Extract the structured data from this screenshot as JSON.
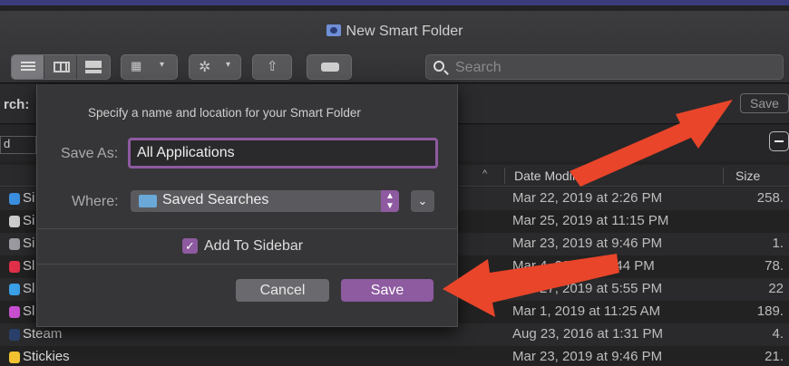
{
  "window": {
    "title": "New Smart Folder"
  },
  "toolbar": {
    "search_placeholder": "Search"
  },
  "criteria": {
    "label": "rch:",
    "header_save": "Save",
    "field_fragment": "d"
  },
  "columns": {
    "date_modified": "Date Modified",
    "size": "Size",
    "sort_indicator": "^"
  },
  "files": [
    {
      "name": "Si",
      "date": "Mar 22, 2019 at 2:26 PM",
      "size": "258.",
      "icon_color": "#3b8fe0"
    },
    {
      "name": "Si",
      "date": "Mar 25, 2019 at 11:15 PM",
      "size": "",
      "icon_color": "#cccccc"
    },
    {
      "name": "Si",
      "date": "Mar 23, 2019 at 9:46 PM",
      "size": "1.",
      "icon_color": "#9a9aa0"
    },
    {
      "name": "Sl",
      "date": "Mar 4, 2018 at 5:44 PM",
      "size": "78.",
      "icon_color": "#e0304a"
    },
    {
      "name": "Sl",
      "date": "Feb 27, 2019 at 5:55 PM",
      "size": "22",
      "icon_color": "#3aa0e8"
    },
    {
      "name": "Sl",
      "date": "Mar 1, 2019 at 11:25 AM",
      "size": "189.",
      "icon_color": "#c84fd0"
    },
    {
      "name": "Steam",
      "date": "Aug 23, 2016 at 1:31 PM",
      "size": "4.",
      "icon_color": "#2a3f6a"
    },
    {
      "name": "Stickies",
      "date": "Mar 23, 2019 at 9:46 PM",
      "size": "21.",
      "icon_color": "#f2c230"
    }
  ],
  "sheet": {
    "prompt": "Specify a name and location for your Smart Folder",
    "save_as_label": "Save As:",
    "save_as_value": "All Applications",
    "where_label": "Where:",
    "where_value": "Saved Searches",
    "add_sidebar_label": "Add To Sidebar",
    "add_sidebar_checked": true,
    "cancel_label": "Cancel",
    "save_label": "Save"
  },
  "colors": {
    "accent": "#8e5aa0",
    "arrow": "#e8452a"
  }
}
